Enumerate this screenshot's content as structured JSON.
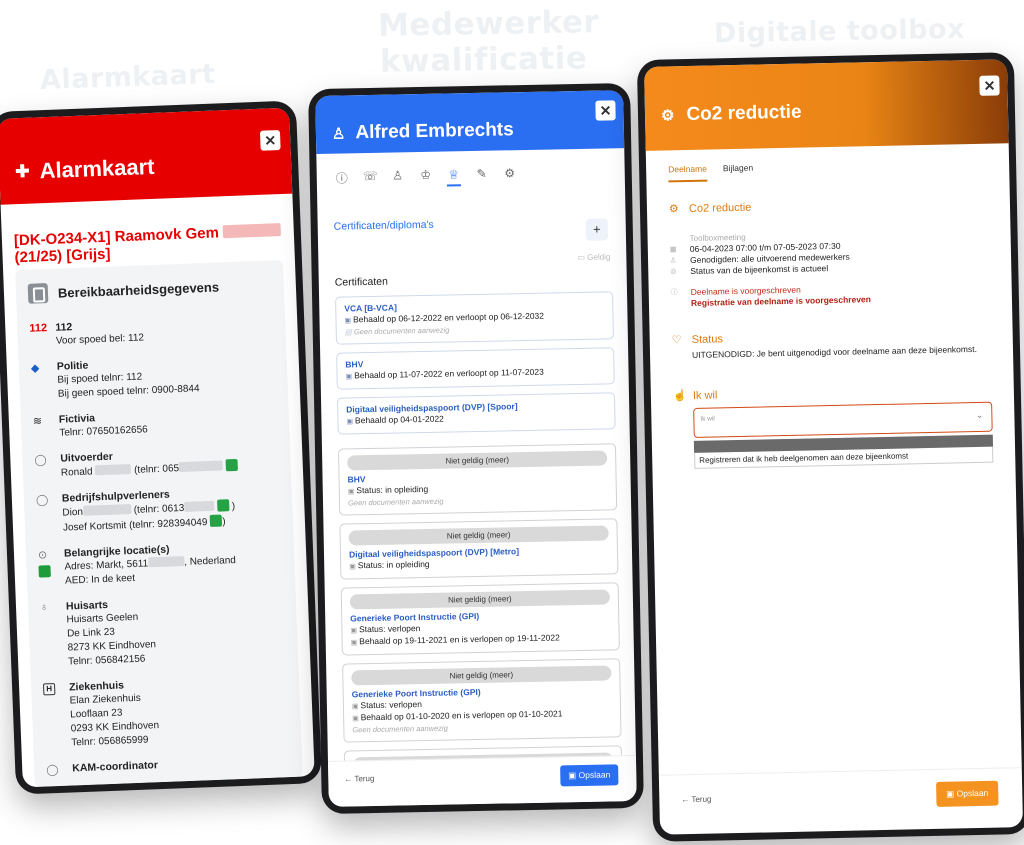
{
  "background_titles": {
    "left": "Alarmkaart",
    "middle_line1": "Medewerker",
    "middle_line2": "kwalificatie",
    "right": "Digitale toolbox"
  },
  "alarmkaart": {
    "title": "Alarmkaart",
    "project_title": "[DK-O234-X1] Raamovk Gem",
    "project_sub": "(21/25) [Grijs]",
    "section": "Bereikbaarheidsgegevens",
    "entries": [
      {
        "icon": "112",
        "head": "112",
        "lines": [
          "Voor spoed bel: 112"
        ]
      },
      {
        "icon": "police-icon",
        "head": "Politie",
        "lines": [
          "Bij spoed telnr: 112",
          "Bij geen spoed telnr: 0900-8844"
        ]
      },
      {
        "icon": "building-icon",
        "head": "Fictivia",
        "lines": [
          "Telnr: 07650162656"
        ]
      },
      {
        "icon": "user-icon",
        "head": "Uitvoerder",
        "lines": [
          "Ronald",
          "(telnr: 065"
        ]
      },
      {
        "icon": "user-icon",
        "head": "Bedrijfshulpverleners",
        "lines": [
          "Dion",
          "(telnr: 0613",
          ")",
          "Josef Kortsmit (telnr: 928394049",
          ")"
        ]
      },
      {
        "icon": "location-icon",
        "head": "Belangrijke locatie(s)",
        "lines": [
          "Adres: Markt, 5611",
          ", Nederland",
          "AED: In de keet"
        ]
      },
      {
        "icon": "doctor-icon",
        "head": "Huisarts",
        "lines": [
          "Huisarts Geelen",
          "De Link 23",
          "8273 KK Eindhoven",
          "Telnr: 056842156"
        ]
      },
      {
        "icon": "hospital-icon",
        "head": "Ziekenhuis",
        "lines": [
          "Elan Ziekenhuis",
          "Looflaan 23",
          "0293 KK Eindhoven",
          "Telnr: 056865999"
        ]
      },
      {
        "icon": "user-icon",
        "head": "KAM-coordinator",
        "lines": []
      }
    ]
  },
  "medewerker": {
    "title": "Alfred Embrechts",
    "link": "Certificaten/diploma's",
    "toggle_label": "Geldig",
    "list_title": "Certificaten",
    "valid": [
      {
        "title": "VCA [B-VCA]",
        "line": "Behaald op 06-12-2022 en verloopt op 06-12-2032",
        "note": "Geen documenten aanwezig"
      },
      {
        "title": "BHV",
        "line": "Behaald op 11-07-2022 en verloopt op 11-07-2023",
        "note": ""
      },
      {
        "title": "Digitaal veiligheidspaspoort (DVP) [Spoor]",
        "line": "Behaald op 04-01-2022",
        "note": ""
      }
    ],
    "invalid_label": "Niet geldig (meer)",
    "invalid": [
      {
        "title": "BHV",
        "line1": "Status: in opleiding",
        "line2": "",
        "note": "Geen documenten aanwezig"
      },
      {
        "title": "Digitaal veiligheidspaspoort (DVP) [Metro]",
        "line1": "Status: in opleiding",
        "line2": "",
        "note": ""
      },
      {
        "title": "Generieke Poort Instructie (GPI)",
        "line1": "Status: verlopen",
        "line2": "Behaald op 19-11-2021 en is verlopen op 19-11-2022",
        "note": ""
      },
      {
        "title": "Generieke Poort Instructie (GPI)",
        "line1": "Status: verlopen",
        "line2": "Behaald op 01-10-2020 en is verlopen op 01-10-2021",
        "note": "Geen documenten aanwezig"
      }
    ],
    "back": "Terug",
    "save": "Opslaan"
  },
  "toolbox": {
    "title": "Co2 reductie",
    "tabs": [
      "Deelname",
      "Bijlagen"
    ],
    "section1": "Co2 reductie",
    "type_label": "Toolboxmeeting",
    "date": "06-04-2023 07:00 t/m 07-05-2023 07:30",
    "invited": "Genodigden: alle uitvoerend medewerkers",
    "status_line": "Status van de bijeenkomst is actueel",
    "required1": "Deelname is voorgeschreven",
    "required2": "Registratie van deelname is voorgeschreven",
    "section2": "Status",
    "status_text": "UITGENODIGD: Je bent uitgenodigd voor deelname aan deze bijeenkomst.",
    "section3": "Ik wil",
    "select_placeholder": "Ik wil",
    "option": "Registreren dat ik heb deelgenomen aan deze bijeenkomst",
    "back": "Terug",
    "save": "Opslaan"
  }
}
